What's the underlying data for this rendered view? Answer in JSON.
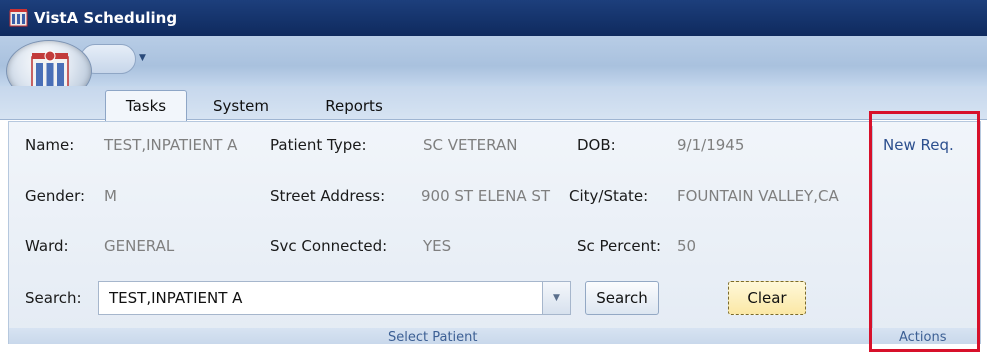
{
  "window": {
    "title": "VistA Scheduling"
  },
  "tabs": [
    {
      "label": "Tasks",
      "active": true
    },
    {
      "label": "System",
      "active": false
    },
    {
      "label": "Reports",
      "active": false
    }
  ],
  "patient": {
    "name_label": "Name:",
    "name_value": "TEST,INPATIENT A",
    "type_label": "Patient Type:",
    "type_value": "SC VETERAN",
    "dob_label": "DOB:",
    "dob_value": "9/1/1945",
    "gender_label": "Gender:",
    "gender_value": "M",
    "street_label": "Street Address:",
    "street_value": "900 ST ELENA ST",
    "city_label": "City/State:",
    "city_value": "FOUNTAIN VALLEY,CA",
    "ward_label": "Ward:",
    "ward_value": "GENERAL",
    "svc_label": "Svc Connected:",
    "svc_value": "YES",
    "sc_label": "Sc Percent:",
    "sc_value": "50"
  },
  "search": {
    "label": "Search:",
    "value": "TEST,INPATIENT A",
    "search_button": "Search",
    "clear_button": "Clear"
  },
  "groups": {
    "select_patient": "Select Patient",
    "actions": "Actions"
  },
  "actions": {
    "new_request": "New Req."
  },
  "colors": {
    "title_bar": "#0f2a5e",
    "highlight_box": "#d7102a",
    "link": "#2c4f8e"
  }
}
